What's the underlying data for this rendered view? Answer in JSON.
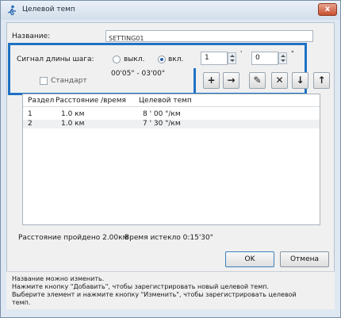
{
  "window": {
    "title": "Целевой темп",
    "close_glyph": "x"
  },
  "form": {
    "name_label": "Название:",
    "name_value": "SETTING01",
    "stride_label": "Сигнал длины шага:",
    "radio_off_label": "выкл.",
    "radio_on_label": "вкл.",
    "radio_selected": "вкл.",
    "minutes_value": "1",
    "seconds_value": "0",
    "minutes_unit": "'",
    "seconds_unit": "\"",
    "standard_label": "Стандарт",
    "standard_checked": false,
    "range_text": "00'05\" - 03'00\""
  },
  "toolbar": [
    {
      "icon": "plus-icon",
      "glyph": "+"
    },
    {
      "icon": "arrow-right-icon",
      "glyph": "→"
    },
    {
      "icon": "pencil-icon",
      "glyph": "✎"
    },
    {
      "icon": "delete-x-icon",
      "glyph": "✕"
    },
    {
      "icon": "arrow-down-icon",
      "glyph": "↓"
    },
    {
      "icon": "arrow-up-icon",
      "glyph": "↑"
    }
  ],
  "table": {
    "headers": [
      "Раздел",
      "Расстояние /время",
      "Целевой темп"
    ],
    "rows": [
      [
        "1",
        "1.0 км",
        "8 ' 00 \"/км"
      ],
      [
        "2",
        "1.0 км",
        "7 ' 30 \"/км"
      ]
    ]
  },
  "status": {
    "distance_text": "Расстояние пройдено 2.00км",
    "time_text": "Время истекло 0:15'30\""
  },
  "buttons": {
    "ok": "OK",
    "cancel": "Отмена"
  },
  "help": [
    "Название можно изменить.",
    "Нажмите кнопку \"Добавить\", чтобы зарегистрировать новый целевой темп.",
    "Выберите элемент и нажмите кнопку \"Изменить\", чтобы зарегистрировать целевой",
    "темп."
  ],
  "colors": {
    "highlight": "#1f72c4",
    "accent": "#2a5fa8",
    "close": "#c8502f"
  }
}
